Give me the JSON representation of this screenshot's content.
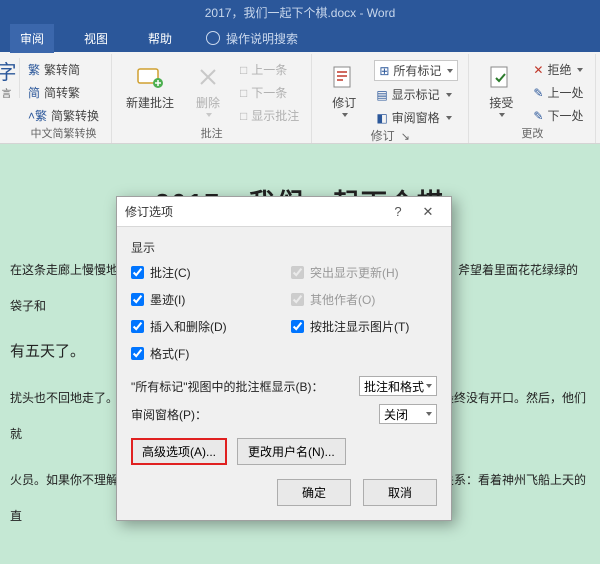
{
  "title": "2017，我们一起下个棋.docx  -  Word",
  "tabs": {
    "review": "审阅",
    "view": "视图",
    "help": "帮助",
    "search": "操作说明搜索"
  },
  "ribbon": {
    "left_char": "字",
    "left_sub": "言",
    "conv": {
      "trad": "繁转简",
      "simp": "简转繁",
      "toggle": "简繁转换",
      "group": "中文简繁转换"
    },
    "comment": {
      "new": "新建批注",
      "delete": "删除",
      "prev": "上一条",
      "next": "下一条",
      "show": "显示批注",
      "group": "批注"
    },
    "track": {
      "track": "修订",
      "all": "所有标记",
      "showmark": "显示标记",
      "pane": "审阅窗格",
      "group": "修订"
    },
    "accept": {
      "accept": "接受",
      "reject": "拒绝",
      "prev": "上一处",
      "next": "下一处",
      "group": "更改"
    }
  },
  "doc": {
    "heading": "2017，我们一起下个棋",
    "p1": "在这条走廊上慢慢地",
    "p1b": "斧望着里面花花绿绿的袋子和",
    "p2": "有五天了。",
    "p3": "扰头也不回地走了。",
    "p3b": "最终没有开口。然后，他们就",
    "p4": "火员。如果你不理解",
    "p4b": "关系：看着神州飞船上天的直"
  },
  "dlg": {
    "title": "修订选项",
    "help": "?",
    "close": "✕",
    "section": "显示",
    "opts": {
      "comment": "批注(C)",
      "highlight": "突出显示更新(H)",
      "ink": "墨迹(I)",
      "others": "其他作者(O)",
      "insdel": "插入和删除(D)",
      "pic": "按批注显示图片(T)",
      "format": "格式(F)"
    },
    "row1_label": "\"所有标记\"视图中的批注框显示(B)：",
    "row1_value": "批注和格式",
    "row2_label": "审阅窗格(P)：",
    "row2_value": "关闭",
    "adv": "高级选项(A)...",
    "user": "更改用户名(N)...",
    "ok": "确定",
    "cancel": "取消"
  }
}
